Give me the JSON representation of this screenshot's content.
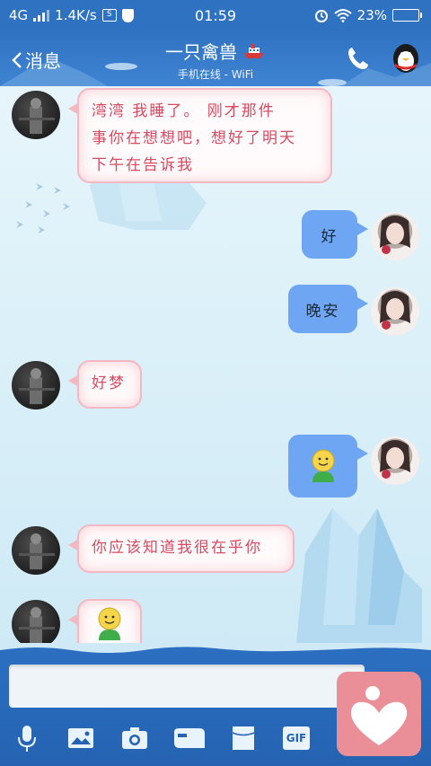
{
  "status_bar": {
    "network": "4G",
    "speed": "1.4K/s",
    "time": "01:59",
    "battery": "23%",
    "battery_level": 0.23,
    "icons": [
      "signal-icon",
      "sim-icon",
      "shield-icon",
      "alarm-icon",
      "wifi-icon",
      "battery-icon"
    ]
  },
  "header": {
    "back_label": "消息",
    "title": "一只禽兽",
    "subtitle": "手机在线 - WiFi",
    "icons": [
      "back-chevron-icon",
      "ship-icon",
      "phone-icon",
      "penguin-icon"
    ]
  },
  "messages": [
    {
      "side": "left",
      "text": "湾湾  我睡了。  刚才那件事你在想想吧，想好了明天下午在告诉我",
      "lines": [
        "湾湾  我睡了。  刚才那件",
        "事你在想想吧，想好了明天",
        "下午在告诉我"
      ]
    },
    {
      "side": "right",
      "text": "好"
    },
    {
      "side": "right",
      "text": "晚安"
    },
    {
      "side": "left",
      "text": "好梦"
    },
    {
      "side": "right",
      "text": "",
      "emoji": "smiley-emoji"
    },
    {
      "side": "left",
      "text": "你应该知道我很在乎你"
    },
    {
      "side": "left",
      "text": "",
      "emoji": "smiley-emoji"
    }
  ],
  "input": {
    "placeholder": ""
  },
  "toolbar": {
    "items": [
      "microphone-icon",
      "photo-icon",
      "camera-icon",
      "red-packet-icon",
      "file-icon",
      "gif-icon"
    ],
    "gif_label": "GIF"
  },
  "colors": {
    "theme_blue": "#2f72c2",
    "left_bubble_text": "#d64b61",
    "left_bubble_border": "#f3b8c1",
    "right_bubble": "#6ea6f3",
    "heart_button": "#ea8f97"
  }
}
